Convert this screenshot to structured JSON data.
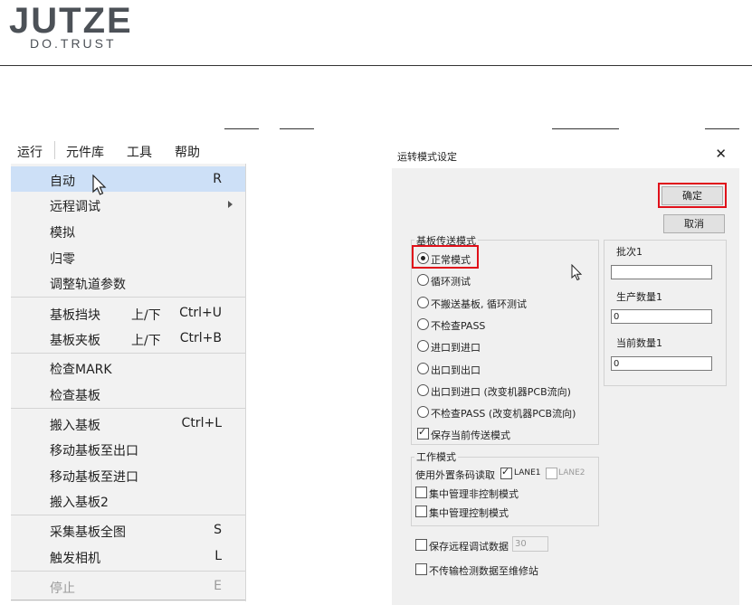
{
  "header": {
    "logo_text": "JUTZE",
    "logo_tagline": "DO.TRUST"
  },
  "menubar": {
    "items": [
      "运行",
      "元件库",
      "工具",
      "帮助"
    ]
  },
  "menu": {
    "items": [
      {
        "label": "自动",
        "shortcut": "R"
      },
      {
        "label": "远程调试"
      },
      {
        "label": "模拟"
      },
      {
        "label": "归零"
      },
      {
        "label": "调整轨道参数"
      },
      {
        "label": "基板挡块",
        "mid": "上/下",
        "shortcut": "Ctrl+U"
      },
      {
        "label": "基板夹板",
        "mid": "上/下",
        "shortcut": "Ctrl+B"
      },
      {
        "label": "检查MARK"
      },
      {
        "label": "检查基板"
      },
      {
        "label": "搬入基板",
        "shortcut": "Ctrl+L"
      },
      {
        "label": "移动基板至出口"
      },
      {
        "label": "移动基板至进口"
      },
      {
        "label": "搬入基板2"
      },
      {
        "label": "采集基板全图",
        "shortcut": "S"
      },
      {
        "label": "触发相机",
        "shortcut": "L"
      },
      {
        "label": "停止",
        "shortcut": "E"
      }
    ]
  },
  "dialog": {
    "title": "运转模式设定",
    "close": "✕",
    "ok": "确定",
    "cancel": "取消",
    "transport_group": "基板传送模式",
    "transport_options": [
      "正常模式",
      "循环测试",
      "不搬送基板, 循环测试",
      "不检查PASS",
      "进口到进口",
      "出口到出口",
      "出口到进口 (改变机器PCB流向)",
      "不检查PASS (改变机器PCB流向)"
    ],
    "save_mode_label": "保存当前传送模式",
    "batch_label": "批次1",
    "batch_value": "",
    "prod_qty_label": "生产数量1",
    "prod_qty_value": "0",
    "curr_qty_label": "当前数量1",
    "curr_qty_value": "0",
    "work_group": "工作模式",
    "barcode_label": "使用外置条码读取",
    "lane1": "LANE1",
    "lane2": "LANE2",
    "central_noctrl": "集中管理非控制模式",
    "central_ctrl": "集中管理控制模式",
    "save_remote": "保存远程调试数据",
    "save_remote_value": "30",
    "no_transfer": "不传输检测数据至维修站"
  }
}
